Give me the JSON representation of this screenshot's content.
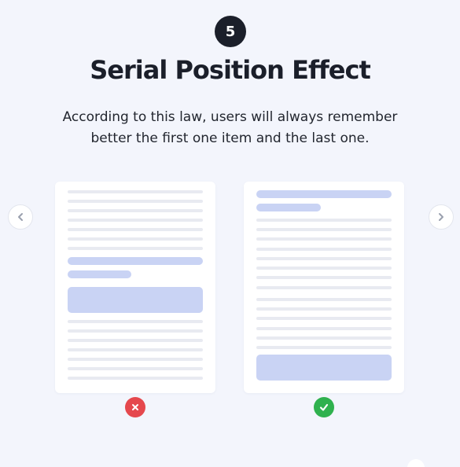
{
  "badge": {
    "number": "5"
  },
  "title": "Serial Position Effect",
  "subtitle": {
    "line1": "According to this law, users will always remember",
    "line2": "better the first one item and the last one."
  },
  "nav": {
    "prev_icon": "chevron-left-icon",
    "next_icon": "chevron-right-icon"
  },
  "examples": [
    {
      "name": "bad-example",
      "status_icon": "x-icon",
      "status_color": "#e5484d"
    },
    {
      "name": "good-example",
      "status_icon": "check-icon",
      "status_color": "#2fb14e"
    }
  ],
  "colors": {
    "background": "#f3f5fc",
    "text": "#1b1f2a",
    "highlight": "#c9d3f4",
    "placeholder_line": "#e8eaf1"
  }
}
